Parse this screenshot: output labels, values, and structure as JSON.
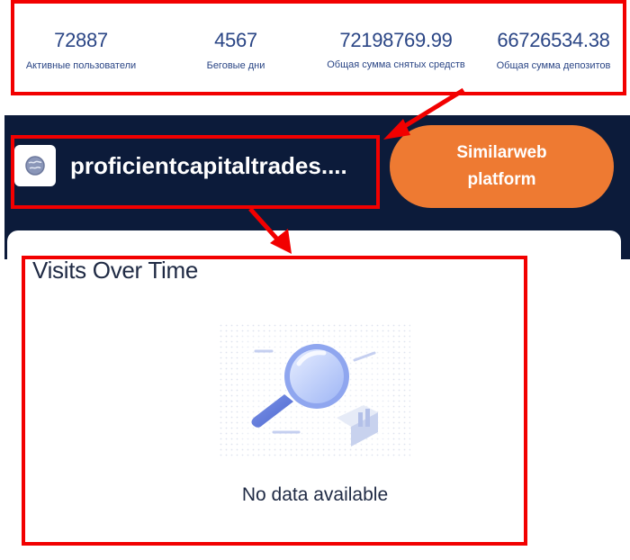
{
  "stats": [
    {
      "value": "72887",
      "label": "Активные пользователи"
    },
    {
      "value": "4567",
      "label": "Беговые дни"
    },
    {
      "value": "72198769.99",
      "label": "Общая сумма снятых средств"
    },
    {
      "value": "66726534.38",
      "label": "Общая сумма депозитов"
    }
  ],
  "site": {
    "domain": "proficientcapitaltrades...."
  },
  "cta": {
    "line1": "Similarweb",
    "line2": "platform"
  },
  "panel": {
    "title": "Visits Over Time",
    "empty_message": "No data available"
  },
  "colors": {
    "accent_orange": "#ee7a32",
    "dark_band": "#0c1b3a",
    "annotation_red": "#f20000",
    "stat_blue": "#2a4585"
  },
  "icons": {
    "site_icon": "globe-icon",
    "empty_illustration": "magnifier-illustration"
  }
}
